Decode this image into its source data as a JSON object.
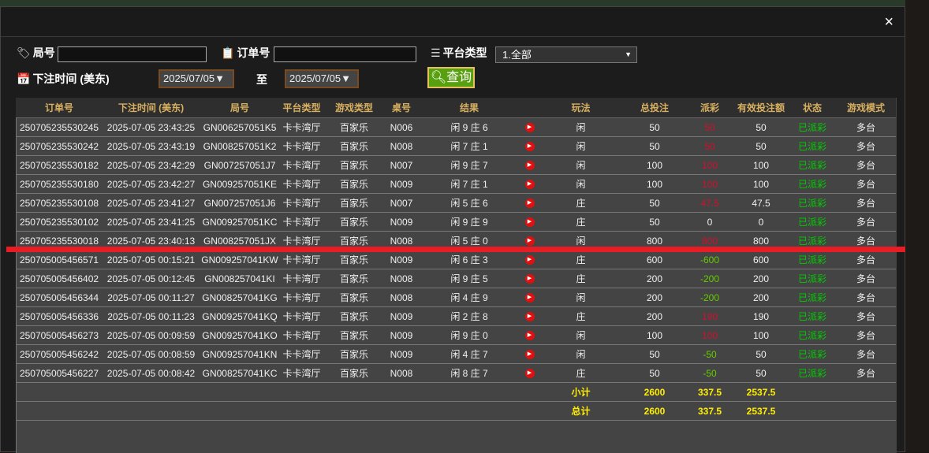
{
  "close_label": "×",
  "filters": {
    "round_label": "局号",
    "round_value": "",
    "order_label": "订单号",
    "order_value": "",
    "platform_label": "平台类型",
    "platform_value": "1.全部",
    "time_label": "下注时间 (美东)",
    "date_from": "2025/07/05▼",
    "to_label": "至",
    "date_to": "2025/07/05▼",
    "query_label": "查询"
  },
  "columns": [
    "订单号",
    "下注时间 (美东)",
    "局号",
    "平台类型",
    "游戏类型",
    "桌号",
    "结果",
    "",
    "玩法",
    "总投注",
    "派彩",
    "有效投注额",
    "状态",
    "游戏模式"
  ],
  "rows": [
    [
      "250705235530245",
      "2025-07-05 23:43:25",
      "GN006257051K5",
      "卡卡湾厅",
      "百家乐",
      "N006",
      "闲 9 庄 6",
      "闲",
      "50",
      "50",
      "50",
      "已派彩",
      "多台"
    ],
    [
      "250705235530242",
      "2025-07-05 23:43:19",
      "GN008257051K2",
      "卡卡湾厅",
      "百家乐",
      "N008",
      "闲 7 庄 1",
      "闲",
      "50",
      "50",
      "50",
      "已派彩",
      "多台"
    ],
    [
      "250705235530182",
      "2025-07-05 23:42:29",
      "GN007257051J7",
      "卡卡湾厅",
      "百家乐",
      "N007",
      "闲 9 庄 7",
      "闲",
      "100",
      "100",
      "100",
      "已派彩",
      "多台"
    ],
    [
      "250705235530180",
      "2025-07-05 23:42:27",
      "GN009257051KE",
      "卡卡湾厅",
      "百家乐",
      "N009",
      "闲 7 庄 1",
      "闲",
      "100",
      "100",
      "100",
      "已派彩",
      "多台"
    ],
    [
      "250705235530108",
      "2025-07-05 23:41:27",
      "GN007257051J6",
      "卡卡湾厅",
      "百家乐",
      "N007",
      "闲 5 庄 6",
      "庄",
      "50",
      "47.5",
      "47.5",
      "已派彩",
      "多台"
    ],
    [
      "250705235530102",
      "2025-07-05 23:41:25",
      "GN009257051KC",
      "卡卡湾厅",
      "百家乐",
      "N009",
      "闲 9 庄 9",
      "庄",
      "50",
      "0",
      "0",
      "已派彩",
      "多台"
    ],
    [
      "250705235530018",
      "2025-07-05 23:40:13",
      "GN008257051JX",
      "卡卡湾厅",
      "百家乐",
      "N008",
      "闲 5 庄 0",
      "闲",
      "800",
      "800",
      "800",
      "已派彩",
      "多台"
    ],
    [
      "250705005456571",
      "2025-07-05 00:15:21",
      "GN009257041KW",
      "卡卡湾厅",
      "百家乐",
      "N009",
      "闲 6 庄 3",
      "庄",
      "600",
      "-600",
      "600",
      "已派彩",
      "多台"
    ],
    [
      "250705005456402",
      "2025-07-05 00:12:45",
      "GN008257041KI",
      "卡卡湾厅",
      "百家乐",
      "N008",
      "闲 9 庄 5",
      "庄",
      "200",
      "-200",
      "200",
      "已派彩",
      "多台"
    ],
    [
      "250705005456344",
      "2025-07-05 00:11:27",
      "GN008257041KG",
      "卡卡湾厅",
      "百家乐",
      "N008",
      "闲 4 庄 9",
      "闲",
      "200",
      "-200",
      "200",
      "已派彩",
      "多台"
    ],
    [
      "250705005456336",
      "2025-07-05 00:11:23",
      "GN009257041KQ",
      "卡卡湾厅",
      "百家乐",
      "N009",
      "闲 2 庄 8",
      "庄",
      "200",
      "190",
      "190",
      "已派彩",
      "多台"
    ],
    [
      "250705005456273",
      "2025-07-05 00:09:59",
      "GN009257041KO",
      "卡卡湾厅",
      "百家乐",
      "N009",
      "闲 9 庄 0",
      "闲",
      "100",
      "100",
      "100",
      "已派彩",
      "多台"
    ],
    [
      "250705005456242",
      "2025-07-05 00:08:59",
      "GN009257041KN",
      "卡卡湾厅",
      "百家乐",
      "N009",
      "闲 4 庄 7",
      "闲",
      "50",
      "-50",
      "50",
      "已派彩",
      "多台"
    ],
    [
      "250705005456227",
      "2025-07-05 00:08:42",
      "GN008257041KC",
      "卡卡湾厅",
      "百家乐",
      "N008",
      "闲 8 庄 7",
      "庄",
      "50",
      "-50",
      "50",
      "已派彩",
      "多台"
    ]
  ],
  "subtotal": {
    "label": "小计",
    "total_bet": "2600",
    "payout": "337.5",
    "valid_bet": "2537.5"
  },
  "grand_total": {
    "label": "总计",
    "total_bet": "2600",
    "payout": "337.5",
    "valid_bet": "2537.5"
  },
  "colors": {
    "positive_payout": "#d0102c",
    "negative_payout": "#66cc00",
    "status": "#00cc00",
    "header_text": "#d8b060",
    "totals": "#ffee00",
    "query_button": "#58a010"
  }
}
